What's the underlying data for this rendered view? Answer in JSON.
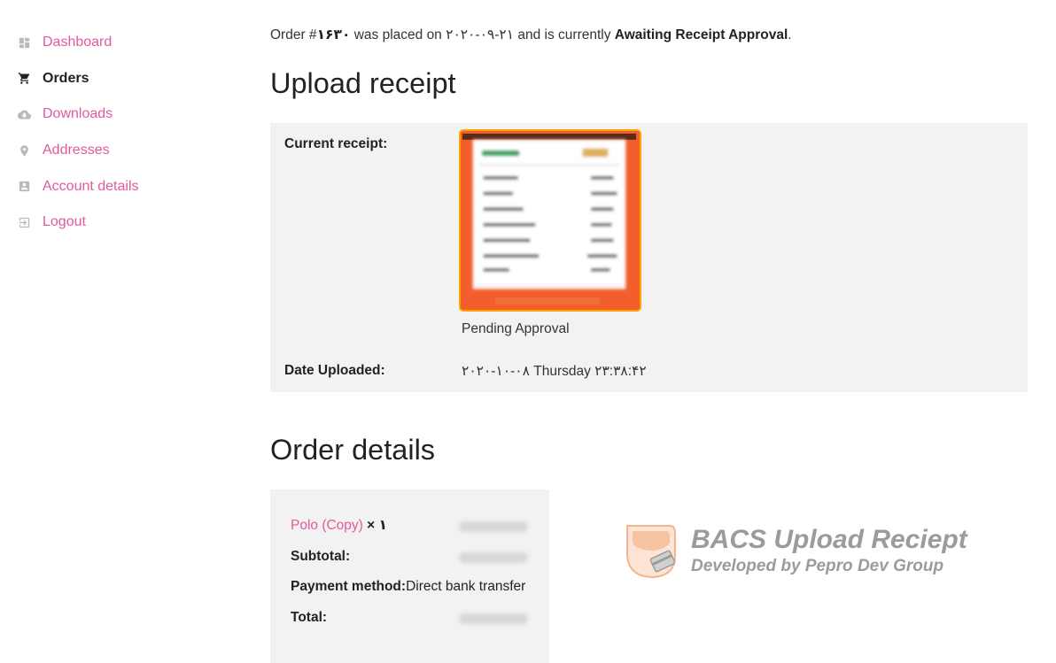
{
  "sidebar": {
    "items": [
      {
        "label": "Dashboard",
        "icon": "dashboard-icon"
      },
      {
        "label": "Orders",
        "icon": "cart-icon",
        "active": true
      },
      {
        "label": "Downloads",
        "icon": "cloud-download-icon"
      },
      {
        "label": "Addresses",
        "icon": "location-pin-icon"
      },
      {
        "label": "Account details",
        "icon": "account-icon"
      },
      {
        "label": "Logout",
        "icon": "logout-icon"
      }
    ]
  },
  "order_summary": {
    "prefix": "Order #",
    "number": "۱۶۳۰",
    "placed_text": " was placed on ",
    "date": "۲۰۲۰-۰۹-۲۱",
    "status_text": " and is currently ",
    "status": "Awaiting Receipt Approval",
    "suffix": "."
  },
  "upload_receipt": {
    "heading": "Upload receipt",
    "current_label": "Current receipt:",
    "receipt_status": "Pending Approval",
    "date_label": "Date Uploaded:",
    "date_value": "۲۰۲۰-۱۰-۰۸ Thursday ۲۳:۳۸:۴۲"
  },
  "order_details": {
    "heading": "Order details",
    "product_name": "Polo (Copy)",
    "product_qty": " × ۱",
    "subtotal_label": "Subtotal:",
    "payment_label": "Payment method:",
    "payment_value": "Direct bank transfer",
    "total_label": "Total:"
  },
  "promo": {
    "title": "BACS Upload Reciept",
    "subtitle": "Developed by Pepro Dev Group"
  },
  "colors": {
    "link": "#e2599c",
    "panel_bg": "#f2f2f2",
    "receipt_border": "#ffa500",
    "receipt_bg": "#f25f2c"
  }
}
